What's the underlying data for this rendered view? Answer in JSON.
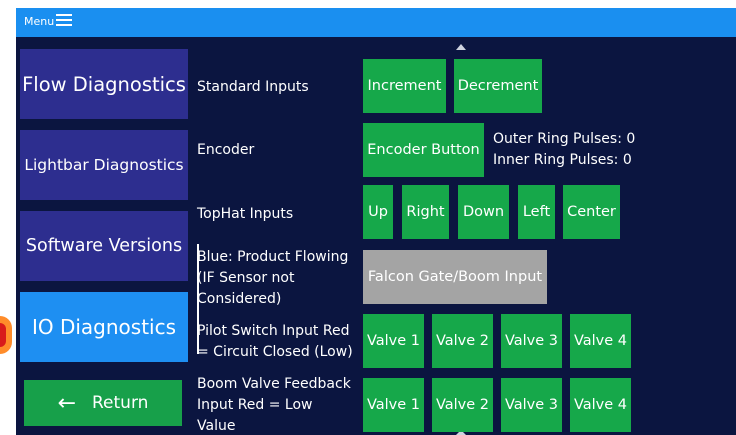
{
  "topbar": {
    "menu_label": "Menu"
  },
  "sidebar": {
    "items": [
      {
        "label": "Flow Diagnostics",
        "active": false
      },
      {
        "label": "Lightbar Diagnostics",
        "active": false
      },
      {
        "label": "Software Versions",
        "active": false
      },
      {
        "label": "IO Diagnostics",
        "active": true
      }
    ],
    "return_label": "Return"
  },
  "rows": {
    "standard_inputs": {
      "label": "Standard Inputs",
      "buttons": [
        "Increment",
        "Decrement"
      ]
    },
    "encoder": {
      "label": "Encoder",
      "button": "Encoder Button",
      "outer_ring": "Outer Ring Pulses: 0",
      "inner_ring": "Inner Ring Pulses: 0"
    },
    "tophat": {
      "label": "TopHat Inputs",
      "buttons": [
        "Up",
        "Right",
        "Down",
        "Left",
        "Center"
      ]
    },
    "product_flowing": {
      "label_lines": [
        "Blue: Product Flowing",
        "(IF Sensor not",
        "Considered)"
      ],
      "button": "Falcon Gate/Boom Input"
    },
    "pilot_switch": {
      "label_lines": [
        "Pilot Switch Input  Red",
        "= Circuit Closed (Low)"
      ],
      "buttons": [
        "Valve 1",
        "Valve 2",
        "Valve 3",
        "Valve 4"
      ]
    },
    "boom_valve": {
      "label_lines": [
        "Boom Valve Feedback",
        "Input  Red = Low",
        "Value"
      ],
      "buttons": [
        "Valve 1",
        "Valve 2",
        "Valve 3",
        "Valve 4"
      ]
    }
  },
  "colors": {
    "background": "#0b1540",
    "topbar": "#1a8ff0",
    "sidebar_button": "#2d2e8f",
    "sidebar_active": "#1e8ff2",
    "green_button": "#16a84a",
    "gray_button": "#a4a4a4"
  }
}
